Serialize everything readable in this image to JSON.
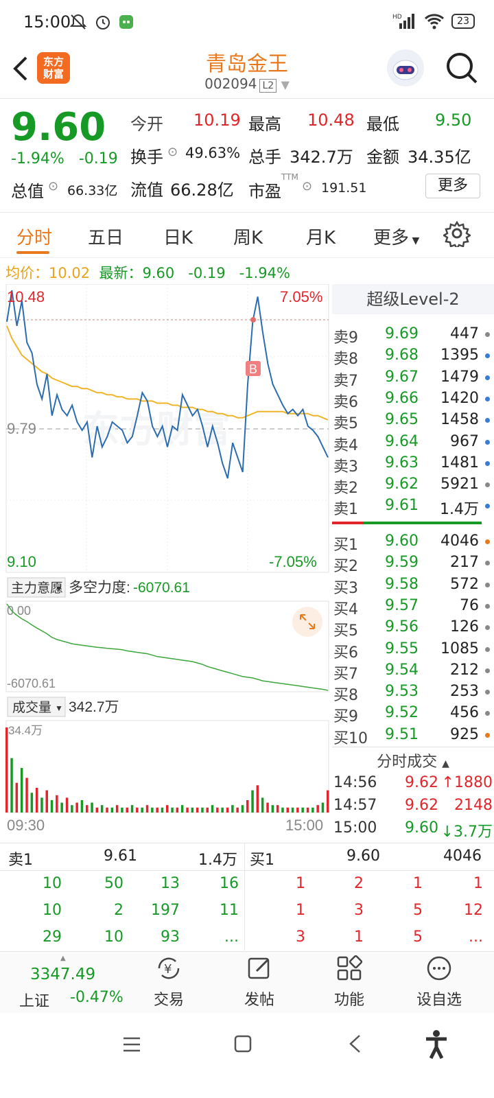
{
  "status": {
    "time": "15:00",
    "network": "HD",
    "battery": "23"
  },
  "header": {
    "logo_line1": "东方",
    "logo_line2": "财富",
    "title": "青岛金王",
    "code": "002094",
    "level_badge": "L2"
  },
  "quote": {
    "price": "9.60",
    "change_pct": "-1.94%",
    "change": "-0.19",
    "open_label": "今开",
    "open": "10.19",
    "high_label": "最高",
    "high": "10.48",
    "low_label": "最低",
    "low": "9.50",
    "turnover_label": "换手",
    "turnover": "49.63%",
    "volume_label": "总手",
    "volume": "342.7万",
    "amount_label": "金额",
    "amount": "34.35亿",
    "mktcap_label": "总值",
    "mktcap": "66.33亿",
    "float_label": "流值",
    "float": "66.28亿",
    "pe_label": "市盈",
    "pe_sup": "TTM",
    "pe": "191.51",
    "more_button": "更多"
  },
  "tabs": [
    "分时",
    "五日",
    "日K",
    "周K",
    "月K",
    "更多"
  ],
  "avg_bar": {
    "avg_label": "均价：10.02",
    "latest_label": "最新：9.60",
    "change": "-0.19",
    "change_pct": "-1.94%"
  },
  "chart": {
    "price_high": "10.48",
    "price_low": "9.10",
    "pct_high": "7.05%",
    "pct_low": "-7.05%",
    "prev_close": "9.79",
    "buy_marker": "B",
    "watermark": "东方财富",
    "indicator_select": "主力意愿",
    "indicator_label": "多空力度:",
    "indicator_value": "-6070.61",
    "ind_top": "0.00",
    "ind_bottom": "-6070.61",
    "vol_select": "成交量",
    "vol_value": "342.7万",
    "vol_max": "34.4万",
    "time_start": "09:30",
    "time_end": "15:00",
    "colors": {
      "price_line": "#2b6cb0",
      "avg_line": "#f0b429",
      "indicator_line": "#3ca63c",
      "up": "#e0262b",
      "down": "#169a25"
    }
  },
  "chart_data": {
    "type": "line",
    "title": "",
    "xlabel": "",
    "ylabel": "",
    "x_range": [
      "09:30",
      "15:00"
    ],
    "ylim": [
      9.1,
      10.48
    ],
    "reference_line": 9.79,
    "series": [
      {
        "name": "",
        "values": [
          10.3,
          10.45,
          10.28,
          10.4,
          10.2,
          10.15,
          10.0,
          9.93,
          10.05,
          9.85,
          9.95,
          9.88,
          9.85,
          9.9,
          9.82,
          9.78,
          9.82,
          9.65,
          9.8,
          9.7,
          9.75,
          9.82,
          9.8,
          9.78,
          9.72,
          9.75,
          9.85,
          9.96,
          9.92,
          9.8,
          9.75,
          9.8,
          9.7,
          9.8,
          9.78,
          9.95,
          9.9,
          9.85,
          9.88,
          9.8,
          9.7,
          9.8,
          9.72,
          9.62,
          9.55,
          9.72,
          9.65,
          9.58,
          10.0,
          10.3,
          10.42,
          10.25,
          10.1,
          10.0,
          9.95,
          9.9,
          9.86,
          9.88,
          9.85,
          9.88,
          9.8,
          9.78,
          9.75,
          9.7,
          9.65
        ]
      },
      {
        "name": "均价",
        "values": [
          10.28,
          10.22,
          10.18,
          10.14,
          10.12,
          10.1,
          10.08,
          10.06,
          10.05,
          10.03,
          10.02,
          10.01,
          10.0,
          9.99,
          9.99,
          9.98,
          9.98,
          9.97,
          9.96,
          9.96,
          9.95,
          9.95,
          9.94,
          9.94,
          9.93,
          9.93,
          9.93,
          9.92,
          9.92,
          9.92,
          9.91,
          9.91,
          9.91,
          9.9,
          9.9,
          9.89,
          9.89,
          9.89,
          9.88,
          9.88,
          9.87,
          9.87,
          9.86,
          9.86,
          9.85,
          9.85,
          9.84,
          9.84,
          9.85,
          9.86,
          9.87,
          9.87,
          9.87,
          9.87,
          9.87,
          9.87,
          9.86,
          9.86,
          9.86,
          9.86,
          9.86,
          9.85,
          9.85,
          9.84,
          9.83
        ]
      }
    ],
    "indicator_series": [
      0,
      -500,
      -800,
      -1050,
      -1250,
      -1480,
      -1700,
      -1900,
      -2100,
      -2350,
      -2500,
      -2600,
      -2700,
      -2800,
      -2850,
      -2900,
      -2950,
      -3000,
      -3050,
      -3080,
      -3120,
      -3150,
      -3180,
      -3220,
      -3300,
      -3350,
      -3400,
      -3450,
      -3500,
      -3600,
      -3700,
      -3750,
      -3800,
      -3850,
      -3900,
      -3950,
      -4000,
      -4050,
      -4150,
      -4250,
      -4400,
      -4500,
      -4600,
      -4700,
      -4800,
      -4900,
      -5000,
      -5100,
      -5150,
      -5200,
      -5300,
      -5400,
      -5450,
      -5500,
      -5550,
      -5600,
      -5650,
      -5700,
      -5750,
      -5800,
      -5850,
      -5900,
      -5950,
      -6000,
      -6070.61
    ],
    "volume": [
      34.4,
      22,
      12,
      18,
      14,
      8,
      10,
      6,
      9,
      5,
      7,
      4,
      6,
      3,
      4,
      5,
      3,
      4,
      2,
      3,
      2,
      2,
      3,
      2,
      2,
      3,
      2,
      2,
      3,
      2,
      2,
      2,
      3,
      2,
      2,
      3,
      2,
      2,
      2,
      2,
      2,
      3,
      2,
      2,
      2,
      3,
      2,
      3,
      5,
      9,
      11,
      6,
      4,
      3,
      3,
      2,
      2,
      2,
      2,
      2,
      2,
      2,
      3,
      4,
      9
    ]
  },
  "orderbook": {
    "header": "超级Level-2",
    "asks": [
      {
        "label": "卖9",
        "price": "9.69",
        "vol": "447",
        "dot": "#888"
      },
      {
        "label": "卖8",
        "price": "9.68",
        "vol": "1395",
        "dot": "#3a7bd5"
      },
      {
        "label": "卖7",
        "price": "9.67",
        "vol": "1479",
        "dot": "#3a7bd5"
      },
      {
        "label": "卖6",
        "price": "9.66",
        "vol": "1420",
        "dot": "#3a7bd5"
      },
      {
        "label": "卖5",
        "price": "9.65",
        "vol": "1458",
        "dot": "#3a7bd5"
      },
      {
        "label": "卖4",
        "price": "9.64",
        "vol": "967",
        "dot": "#3a7bd5"
      },
      {
        "label": "卖3",
        "price": "9.63",
        "vol": "1481",
        "dot": "#3a7bd5"
      },
      {
        "label": "卖2",
        "price": "9.62",
        "vol": "5921",
        "dot": "#888"
      },
      {
        "label": "卖1",
        "price": "9.61",
        "vol": "1.4万",
        "dot": "#3a7bd5"
      }
    ],
    "bids": [
      {
        "label": "买1",
        "price": "9.60",
        "vol": "4046",
        "dot": "#e8791c"
      },
      {
        "label": "买2",
        "price": "9.59",
        "vol": "217",
        "dot": "#888"
      },
      {
        "label": "买3",
        "price": "9.58",
        "vol": "572",
        "dot": "#888"
      },
      {
        "label": "买4",
        "price": "9.57",
        "vol": "76",
        "dot": "#888"
      },
      {
        "label": "买5",
        "price": "9.56",
        "vol": "126",
        "dot": "#888"
      },
      {
        "label": "买6",
        "price": "9.55",
        "vol": "1085",
        "dot": "#888"
      },
      {
        "label": "买7",
        "price": "9.54",
        "vol": "212",
        "dot": "#888"
      },
      {
        "label": "买8",
        "price": "9.53",
        "vol": "253",
        "dot": "#888"
      },
      {
        "label": "买9",
        "price": "9.52",
        "vol": "456",
        "dot": "#888"
      },
      {
        "label": "买10",
        "price": "9.51",
        "vol": "925",
        "dot": "#e8791c"
      }
    ],
    "tape_header": "分时成交",
    "tape": [
      {
        "time": "14:56",
        "price": "9.62",
        "arrow": "↑",
        "vol": "1880",
        "color": "#e0262b"
      },
      {
        "time": "14:57",
        "price": "9.62",
        "arrow": "",
        "vol": "2148",
        "color": "#e0262b"
      },
      {
        "time": "15:00",
        "price": "9.60",
        "arrow": "↓",
        "vol": "3.7万",
        "color": "#169a25"
      }
    ]
  },
  "deepbook": {
    "sell_label": "卖1",
    "sell_price": "9.61",
    "sell_vol": "1.4万",
    "buy_label": "买1",
    "buy_price": "9.60",
    "buy_vol": "4046",
    "sell_rows": [
      [
        "10",
        "50",
        "13",
        "16"
      ],
      [
        "10",
        "2",
        "197",
        "11"
      ],
      [
        "29",
        "10",
        "93",
        "..."
      ]
    ],
    "buy_rows": [
      [
        "1",
        "2",
        "1",
        "1"
      ],
      [
        "1",
        "3",
        "5",
        "12"
      ],
      [
        "3",
        "1",
        "5",
        "..."
      ]
    ]
  },
  "bottom": {
    "index_value": "3347.49",
    "index_name": "上证",
    "index_change": "-0.47%",
    "trade": "交易",
    "post": "发帖",
    "functions": "功能",
    "watchlist": "设自选"
  }
}
